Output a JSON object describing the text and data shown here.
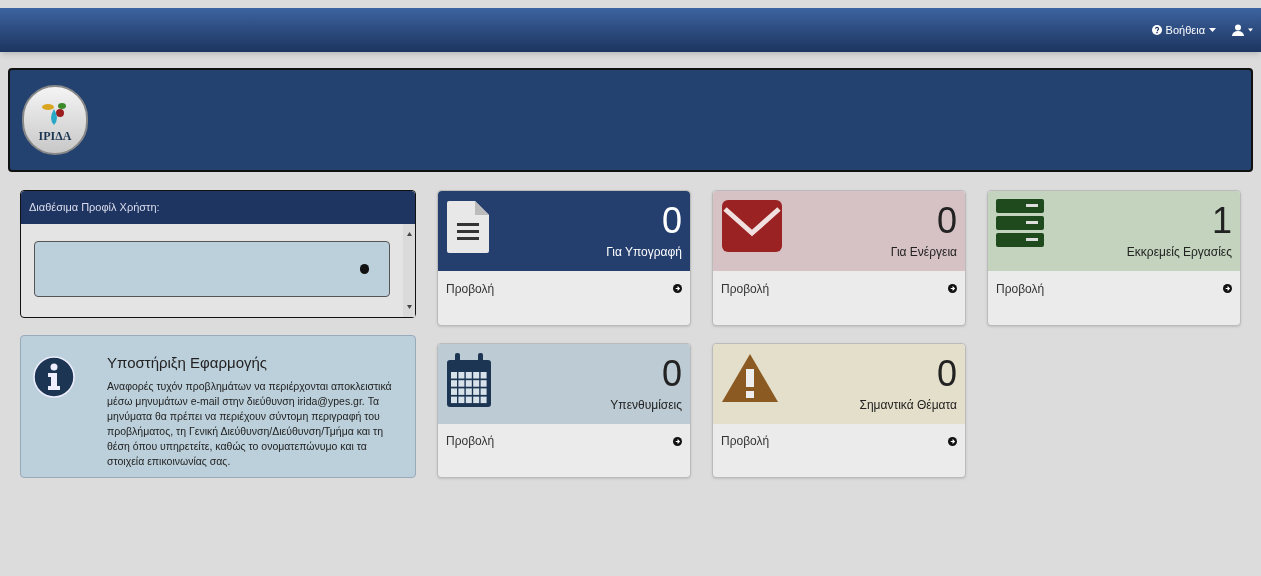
{
  "navbar": {
    "help": "Βοήθεια"
  },
  "banner": {
    "logo_text": "ΙΡΙΔΑ"
  },
  "profiles": {
    "title": "Διαθέσιμα Προφίλ Χρήστη:"
  },
  "support": {
    "title": "Υποστήριξη Εφαρμογής",
    "text": "Αναφορές τυχόν προβλημάτων να περιέρχονται αποκλειστικά μέσω μηνυμάτων e-mail στην διεύθυνση irida@ypes.gr. Τα μηνύματα θα πρέπει να περιέχουν σύντομη περιγραφή του προβλήματος, τη Γενική Διεύθυνση/Διεύθυνση/Τμήμα και τη θέση όπου υπηρετείτε, καθώς το ονοματεπώνυμο και τα στοιχεία επικοινωνίας σας."
  },
  "tiles": [
    {
      "kind": "document",
      "color": "#243f6e",
      "count": "0",
      "label": "Για Υπογραφή",
      "link": "Προβολή"
    },
    {
      "kind": "envelope",
      "color": "#d6c2c5",
      "count": "0",
      "label": "Για Ενέργεια",
      "link": "Προβολή"
    },
    {
      "kind": "server",
      "color": "#c3d3bd",
      "count": "1",
      "label": "Εκκρεμείς Εργασίες",
      "link": "Προβολή"
    },
    {
      "kind": "calendar",
      "color": "#bccbd4",
      "count": "0",
      "label": "Υπενθυμίσεις",
      "link": "Προβολή"
    },
    {
      "kind": "warning",
      "color": "#e4dfca",
      "count": "0",
      "label": "Σημαντικά Θέματα",
      "link": "Προβολή"
    }
  ]
}
